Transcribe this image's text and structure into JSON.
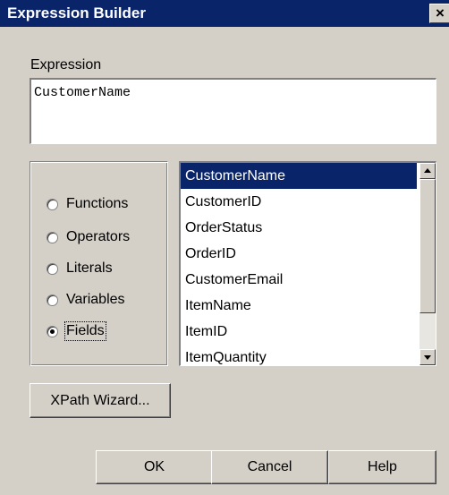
{
  "window": {
    "title": "Expression Builder",
    "close_glyph": "×"
  },
  "expression": {
    "label": "Expression",
    "value": "CustomerName"
  },
  "categories": [
    {
      "label": "Functions",
      "checked": false
    },
    {
      "label": "Operators",
      "checked": false
    },
    {
      "label": "Literals",
      "checked": false
    },
    {
      "label": "Variables",
      "checked": false
    },
    {
      "label": "Fields",
      "checked": true
    }
  ],
  "fields_list": {
    "items": [
      "CustomerName",
      "CustomerID",
      "OrderStatus",
      "OrderID",
      "CustomerEmail",
      "ItemName",
      "ItemID",
      "ItemQuantity"
    ],
    "selected": "CustomerName"
  },
  "buttons": {
    "xpath_wizard": "XPath Wizard...",
    "ok": "OK",
    "cancel": "Cancel",
    "help": "Help"
  },
  "colors": {
    "titlebar": "#0a246a",
    "dialog_bg": "#d4d0c8",
    "selection": "#0a246a"
  }
}
